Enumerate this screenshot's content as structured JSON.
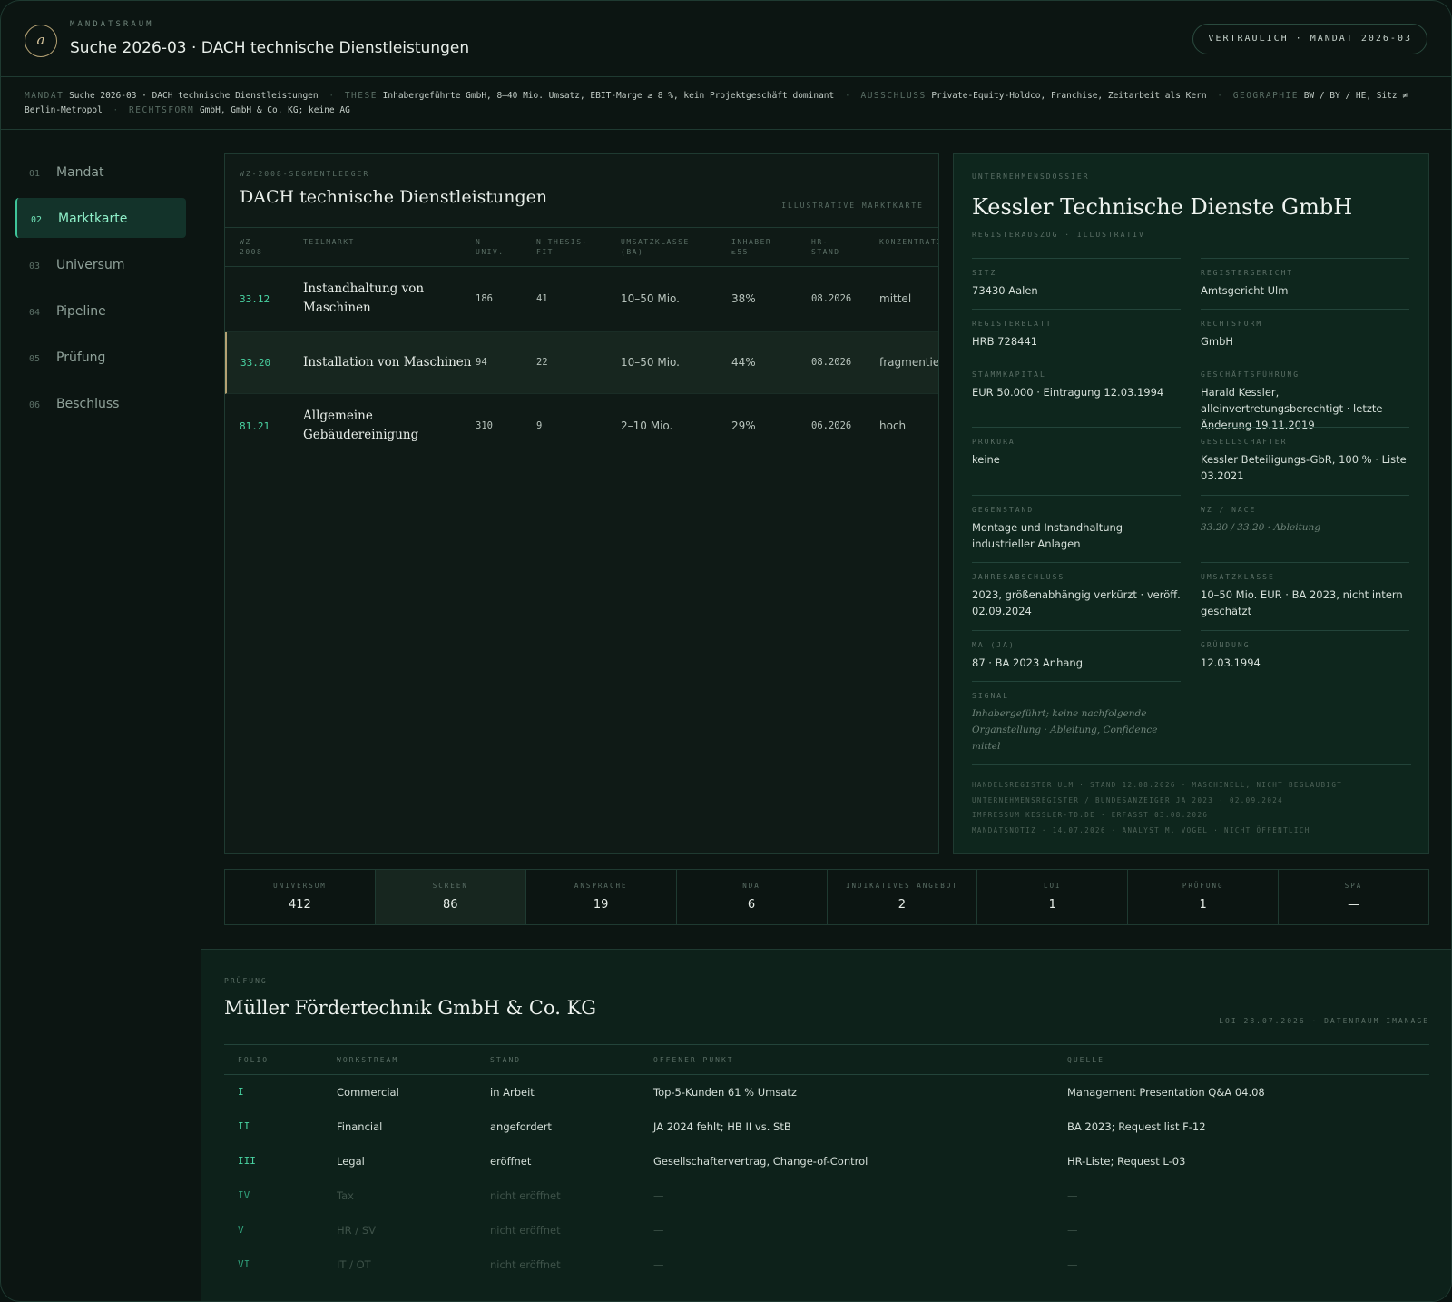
{
  "header": {
    "logo": "a",
    "kicker": "MANDATSRAUM",
    "title": "Suche 2026-03 · DACH technische Dienstleistungen",
    "confidential": "VERTRAULICH · MANDAT 2026-03"
  },
  "mandate_line": {
    "mandat_k": "MANDAT",
    "mandat_v": "Suche 2026-03 · DACH technische Dienstleistungen",
    "these_k": "THESE",
    "these_v": "Inhabergeführte GmbH, 8–40 Mio. Umsatz, EBIT-Marge ≥ 8 %, kein Projektgeschäft dominant",
    "ausschluss_k": "AUSSCHLUSS",
    "ausschluss_v": "Private-Equity-Holdco, Franchise, Zeitarbeit als Kern",
    "geo_k": "GEOGRAPHIE",
    "geo_v": "BW / BY / HE, Sitz ≠ Berlin-Metropol",
    "rf_k": "RECHTSFORM",
    "rf_v": "GmbH, GmbH & Co. KG; keine AG",
    "sep": "·"
  },
  "nav": [
    {
      "num": "01",
      "label": "Mandat"
    },
    {
      "num": "02",
      "label": "Marktkarte"
    },
    {
      "num": "03",
      "label": "Universum"
    },
    {
      "num": "04",
      "label": "Pipeline"
    },
    {
      "num": "05",
      "label": "Prüfung"
    },
    {
      "num": "06",
      "label": "Beschluss"
    }
  ],
  "ledger": {
    "kicker": "WZ-2008-SEGMENTLEDGER",
    "title": "DACH technische Dienstleistungen",
    "note": "ILLUSTRATIVE MARKTKARTE",
    "columns": [
      "WZ\n2008",
      "TEILMARKT",
      "N\nUNIV.",
      "N THESIS-\nFIT",
      "UMSATZKLASSE\n(BA)",
      "INHABER\n≥55",
      "HR-\nSTAND",
      "KONZENTRATION"
    ],
    "rows": [
      {
        "wz": "33.12",
        "name": "Instandhaltung von Maschinen",
        "univ": "186",
        "fit": "41",
        "umsatz": "10–50 Mio.",
        "inhaber": "38%",
        "hr": "08.2026",
        "konz": "mittel"
      },
      {
        "wz": "33.20",
        "name": "Installation von Maschinen",
        "univ": "94",
        "fit": "22",
        "umsatz": "10–50 Mio.",
        "inhaber": "44%",
        "hr": "08.2026",
        "konz": "fragmentiert"
      },
      {
        "wz": "81.21",
        "name": "Allgemeine Gebäudereinigung",
        "univ": "310",
        "fit": "9",
        "umsatz": "2–10 Mio.",
        "inhaber": "29%",
        "hr": "06.2026",
        "konz": "hoch"
      }
    ]
  },
  "dossier": {
    "kicker": "UNTERNEHMENSDOSSIER",
    "title": "Kessler Technische Dienste GmbH",
    "sub": "REGISTERAUSZUG · ILLUSTRATIV",
    "fields": [
      {
        "label": "SITZ",
        "value": "73430 Aalen"
      },
      {
        "label": "REGISTERGERICHT",
        "value": "Amtsgericht Ulm"
      },
      {
        "label": "REGISTERBLATT",
        "value": "HRB 728441"
      },
      {
        "label": "RECHTSFORM",
        "value": "GmbH"
      },
      {
        "label": "STAMMKAPITAL",
        "value": "EUR 50.000 · Eintragung 12.03.1994"
      },
      {
        "label": "GESCHÄFTSFÜHRUNG",
        "value": "Harald Kessler, alleinvertretungsberechtigt · letzte Änderung 19.11.2019"
      },
      {
        "label": "PROKURA",
        "value": "keine"
      },
      {
        "label": "GESELLSCHAFTER",
        "value": "Kessler Beteiligungs-GbR, 100 % · Liste 03.2021"
      },
      {
        "label": "GEGENSTAND",
        "value": "Montage und Instandhaltung industrieller Anlagen"
      },
      {
        "label": "WZ / NACE",
        "value": "33.20 / 33.20 · Ableitung"
      },
      {
        "label": "JAHRESABSCHLUSS",
        "value": "2023, größenabhängig verkürzt · veröff. 02.09.2024"
      },
      {
        "label": "UMSATZKLASSE",
        "value": "10–50 Mio. EUR · BA 2023, nicht intern geschätzt"
      },
      {
        "label": "MA (JA)",
        "value": "87 · BA 2023 Anhang"
      },
      {
        "label": "GRÜNDUNG",
        "value": "12.03.1994"
      },
      {
        "label": "SIGNAL",
        "value": "Inhabergeführt; keine nachfolgende Organstellung · Ableitung, Confidence mittel"
      }
    ],
    "sources": [
      "HANDELSREGISTER ULM · STAND 12.08.2026 · MASCHINELL, NICHT BEGLAUBIGT",
      "UNTERNEHMENSREGISTER / BUNDESANZEIGER JA 2023 · 02.09.2024",
      "IMPRESSUM KESSLER-TD.DE · ERFASST 03.08.2026",
      "MANDATSNOTIZ · 14.07.2026 · ANALYST M. VOGEL · NICHT ÖFFENTLICH"
    ]
  },
  "funnel": [
    {
      "label": "UNIVERSUM",
      "value": "412"
    },
    {
      "label": "SCREEN",
      "value": "86"
    },
    {
      "label": "ANSPRACHE",
      "value": "19"
    },
    {
      "label": "NDA",
      "value": "6"
    },
    {
      "label": "INDIKATIVES ANGEBOT",
      "value": "2"
    },
    {
      "label": "LOI",
      "value": "1"
    },
    {
      "label": "PRÜFUNG",
      "value": "1"
    },
    {
      "label": "SPA",
      "value": "—"
    }
  ],
  "pruefung": {
    "kicker": "PRÜFUNG",
    "title": "Müller Fördertechnik GmbH & Co. KG",
    "note": "LOI 28.07.2026 · DATENRAUM IMANAGE",
    "columns": [
      "FOLIO",
      "WORKSTREAM",
      "STAND",
      "OFFENER PUNKT",
      "QUELLE"
    ],
    "rows": [
      {
        "folio": "I",
        "ws": "Commercial",
        "stand": "in Arbeit",
        "punkt": "Top-5-Kunden 61 % Umsatz",
        "quelle": "Management Presentation Q&A 04.08"
      },
      {
        "folio": "II",
        "ws": "Financial",
        "stand": "angefordert",
        "punkt": "JA 2024 fehlt; HB II vs. StB",
        "quelle": "BA 2023; Request list F-12"
      },
      {
        "folio": "III",
        "ws": "Legal",
        "stand": "eröffnet",
        "punkt": "Gesellschaftervertrag, Change-of-Control",
        "quelle": "HR-Liste; Request L-03"
      },
      {
        "folio": "IV",
        "ws": "Tax",
        "stand": "nicht eröffnet",
        "punkt": "—",
        "quelle": "—"
      },
      {
        "folio": "V",
        "ws": "HR / SV",
        "stand": "nicht eröffnet",
        "punkt": "—",
        "quelle": "—"
      },
      {
        "folio": "VI",
        "ws": "IT / OT",
        "stand": "nicht eröffnet",
        "punkt": "—",
        "quelle": "—"
      }
    ]
  },
  "colors": {
    "accent": "#49d3a2",
    "gold": "#b5a274",
    "bg": "#0c1512"
  }
}
